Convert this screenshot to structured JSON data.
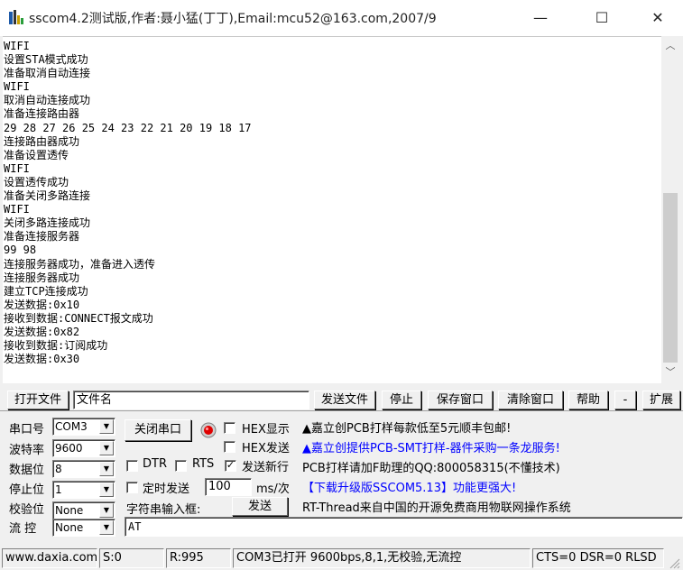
{
  "window": {
    "title": "sscom4.2测试版,作者:聂小猛(丁丁),Email:mcu52@163.com,2007/9",
    "minimize_glyph": "—",
    "maximize_glyph": "☐",
    "close_glyph": "✕"
  },
  "output": {
    "text": "WIFI\n设置STA模式成功\n准备取消自动连接\nWIFI\n取消自动连接成功\n准备连接路由器\n29 28 27 26 25 24 23 22 21 20 19 18 17\n连接路由器成功\n准备设置透传\nWIFI\n设置透传成功\n准备关闭多路连接\nWIFI\n关闭多路连接成功\n准备连接服务器\n99 98\n连接服务器成功，准备进入透传\n连接服务器成功\n建立TCP连接成功\n发送数据:0x10\n接收到数据:CONNECT报文成功\n发送数据:0x82\n接收到数据:订阅成功\n发送数据:0x30",
    "scroll_up": "︿",
    "scroll_down": "﹀"
  },
  "toolbar": {
    "open_file": "打开文件",
    "filename_value": "文件名",
    "send_file": "发送文件",
    "stop": "停止",
    "save_window": "保存窗口",
    "clear_window": "清除窗口",
    "help": "帮助",
    "minus": "-",
    "expand": "扩展"
  },
  "serial": {
    "port_label": "串口号",
    "port_value": "COM3",
    "baud_label": "波特率",
    "baud_value": "9600",
    "data_bits_label": "数据位",
    "data_bits_value": "8",
    "stop_bits_label": "停止位",
    "stop_bits_value": "1",
    "parity_label": "校验位",
    "parity_value": "None",
    "flow_label": "流 控",
    "flow_value": "None",
    "close_port_button": "关闭串口"
  },
  "options": {
    "hex_display": "HEX显示",
    "hex_send": "HEX发送",
    "dtr": "DTR",
    "rts": "RTS",
    "send_newline": "发送新行",
    "timed_send": "定时发送",
    "interval_value": "100",
    "interval_unit": "ms/次",
    "string_input_label": "字符串输入框:",
    "send_button": "发送",
    "input_value": "AT"
  },
  "info": {
    "line1": "▲嘉立创PCB打样每款低至5元顺丰包邮!",
    "line2": "▲嘉立创提供PCB-SMT打样-器件采购一条龙服务!",
    "line3": "PCB打样请加F助理的QQ:800058315(不懂技术)",
    "line4": "【下载升级版SSCOM5.13】功能更强大!",
    "line5": "RT-Thread来自中国的开源免费商用物联网操作系统",
    "line1_color": "#000000",
    "line2_color": "#0000ff",
    "line4_color": "#0000ff"
  },
  "status": {
    "website": "www.daxia.com",
    "sent": "S:0",
    "received": "R:995",
    "port_status": "COM3已打开  9600bps,8,1,无校验,无流控",
    "signals": "CTS=0 DSR=0 RLSD"
  }
}
